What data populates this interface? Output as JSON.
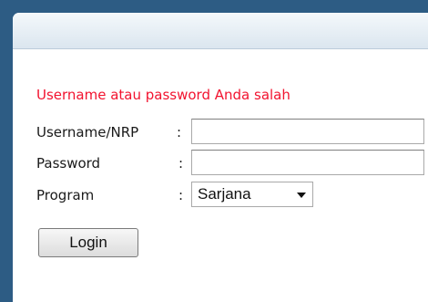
{
  "form": {
    "error_message": "Username atau password Anda salah",
    "username": {
      "label": "Username/NRP",
      "colon": ":",
      "value": ""
    },
    "password": {
      "label": "Password",
      "colon": ":",
      "value": ""
    },
    "program": {
      "label": "Program",
      "colon": ":",
      "selected": "Sarjana"
    },
    "login_label": "Login"
  },
  "colors": {
    "background": "#2d5c84",
    "error": "#f2132f",
    "panel": "#ffffff"
  }
}
